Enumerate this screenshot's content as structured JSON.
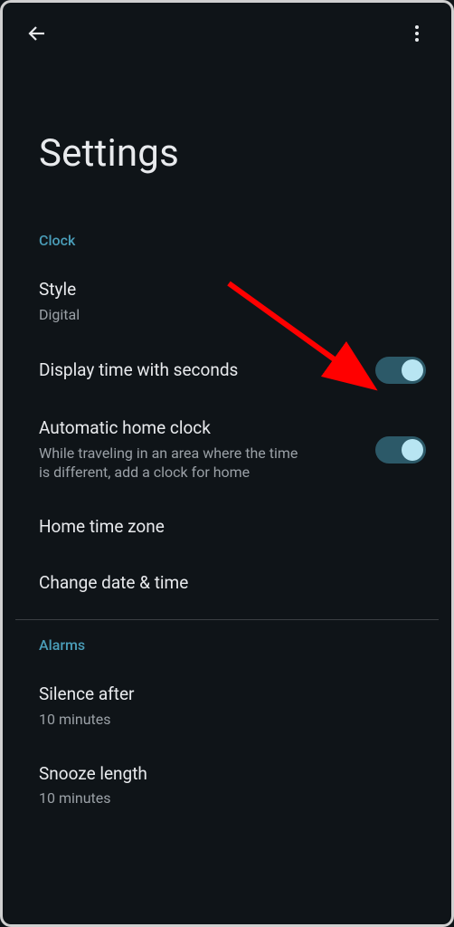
{
  "header": {
    "title": "Settings"
  },
  "sections": {
    "clock": {
      "label": "Clock",
      "style": {
        "title": "Style",
        "value": "Digital"
      },
      "display_seconds": {
        "title": "Display time with seconds",
        "on": true
      },
      "auto_home": {
        "title": "Automatic home clock",
        "desc": "While traveling in an area where the time is different, add a clock for home",
        "on": true
      },
      "home_tz": {
        "title": "Home time zone"
      },
      "change_dt": {
        "title": "Change date & time"
      }
    },
    "alarms": {
      "label": "Alarms",
      "silence": {
        "title": "Silence after",
        "value": "10 minutes"
      },
      "snooze": {
        "title": "Snooze length",
        "value": "10 minutes"
      }
    }
  },
  "annotation": {
    "color": "#ff0000"
  }
}
